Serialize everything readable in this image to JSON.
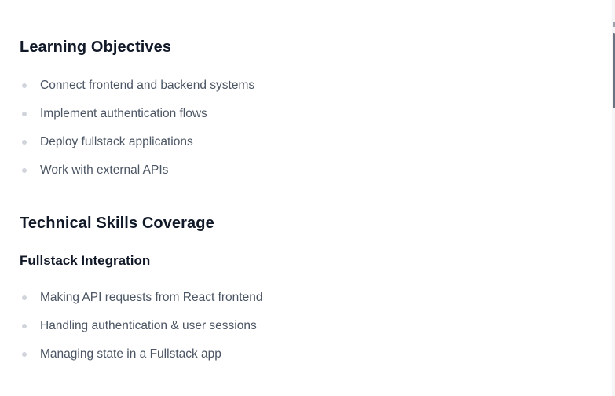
{
  "learning_objectives": {
    "title": "Learning Objectives",
    "items": [
      "Connect frontend and backend systems",
      "Implement authentication flows",
      "Deploy fullstack applications",
      "Work with external APIs"
    ]
  },
  "technical_skills": {
    "title": "Technical Skills Coverage",
    "subsection": {
      "title": "Fullstack Integration",
      "items": [
        "Making API requests from React frontend",
        "Handling authentication & user sessions",
        "Managing state in a Fullstack app"
      ]
    }
  },
  "colors": {
    "heading": "#111827",
    "body_text": "#4b5563",
    "bullet": "#d1d5db",
    "background": "#ffffff"
  }
}
